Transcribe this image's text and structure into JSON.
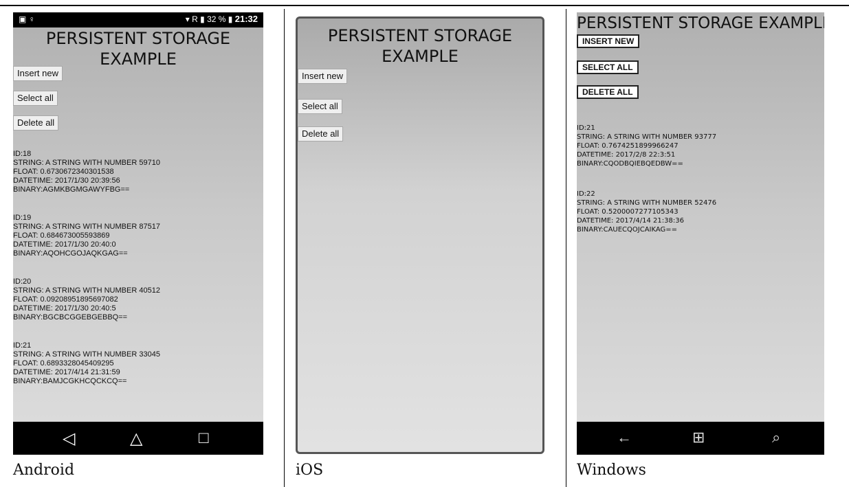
{
  "android": {
    "caption": "Android",
    "status": {
      "left_icons": "▣ ♀",
      "signal": "▾ R ▮",
      "battery": "32 %",
      "time": "21:32"
    },
    "title_line1": "PERSISTENT STORAGE",
    "title_line2": "EXAMPLE",
    "buttons": [
      "Insert new",
      "Select all",
      "Delete all"
    ],
    "records": [
      {
        "id": "ID:18",
        "string": "STRING: A STRING WITH NUMBER 59710",
        "float": "FLOAT: 0.6730672340301538",
        "datetime": "DATETIME: 2017/1/30 20:39:56",
        "binary": "BINARY:AGMKBGMGAWYFBG=="
      },
      {
        "id": "ID:19",
        "string": "STRING: A STRING WITH NUMBER 87517",
        "float": "FLOAT: 0.684673005593869",
        "datetime": "DATETIME: 2017/1/30 20:40:0",
        "binary": "BINARY:AQOHCGOJAQKGAG=="
      },
      {
        "id": "ID:20",
        "string": "STRING: A STRING WITH NUMBER 40512",
        "float": "FLOAT: 0.09208951895697082",
        "datetime": "DATETIME: 2017/1/30 20:40:5",
        "binary": "BINARY:BGCBCGGEBGEBBQ=="
      },
      {
        "id": "ID:21",
        "string": "STRING: A STRING WITH NUMBER 33045",
        "float": "FLOAT: 0.6893328045409295",
        "datetime": "DATETIME: 2017/4/14 21:31:59",
        "binary": "BINARY:BAMJCGKHCQCKCQ=="
      }
    ],
    "nav": {
      "back": "◁",
      "home": "△",
      "recents": "□"
    }
  },
  "ios": {
    "caption": "iOS",
    "title_line1": "PERSISTENT STORAGE",
    "title_line2": "EXAMPLE",
    "buttons": [
      "Insert new",
      "Select all",
      "Delete all"
    ]
  },
  "windows": {
    "caption": "Windows",
    "title": "PERSISTENT STORAGE EXAMPLE",
    "buttons": [
      "INSERT NEW",
      "SELECT ALL",
      "DELETE ALL"
    ],
    "records": [
      {
        "id": "ID:21",
        "string": "STRING: A STRING WITH NUMBER 93777",
        "float": "FLOAT: 0.7674251899966247",
        "datetime": "DATETIME: 2017/2/8 22:3:51",
        "binary": "BINARY:CQODBQIEBQEDBW=="
      },
      {
        "id": "ID:22",
        "string": "STRING: A STRING WITH NUMBER 52476",
        "float": "FLOAT: 0.5200007277105343",
        "datetime": "DATETIME: 2017/4/14 21:38:36",
        "binary": "BINARY:CAUECQOJCAIKAG=="
      }
    ],
    "nav": {
      "back": "←",
      "start": "⊞",
      "search": "⌕"
    }
  }
}
